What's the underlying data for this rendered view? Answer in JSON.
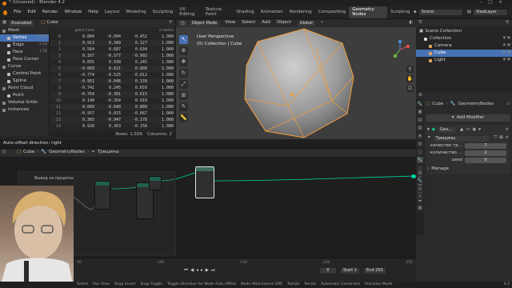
{
  "title": "* (Unsaved) - Blender 4.2",
  "menu": [
    "File",
    "Edit",
    "Render",
    "Window",
    "Help"
  ],
  "workspaces": [
    "Layout",
    "Modeling",
    "Sculpting",
    "UV Editing",
    "Texture Paint",
    "Shading",
    "Animation",
    "Rendering",
    "Compositing",
    "Geometry Nodes",
    "Scripting"
  ],
  "active_workspace": "Geometry Nodes",
  "scene_field": "Scene",
  "viewlayer_field": "ViewLayer",
  "spreadsheet": {
    "mode": "Evaluated",
    "object": "Cube",
    "tree": [
      {
        "label": "Mesh",
        "count": "",
        "indent": 0,
        "color": "#8a8a8a",
        "sel": false
      },
      {
        "label": "Vertex",
        "count": "1,556",
        "indent": 1,
        "color": "#bfbfbf",
        "sel": true
      },
      {
        "label": "Edge",
        "count": "2,16",
        "indent": 1,
        "color": "#bfbfbf",
        "sel": false
      },
      {
        "label": "Face",
        "count": "1,56",
        "indent": 1,
        "color": "#bfbfbf",
        "sel": false
      },
      {
        "label": "Face Corner",
        "count": "",
        "indent": 1,
        "color": "#bfbfbf",
        "sel": false
      },
      {
        "label": "Curve",
        "count": "",
        "indent": 0,
        "color": "#8a8a8a",
        "sel": false
      },
      {
        "label": "Control Point",
        "count": "",
        "indent": 1,
        "color": "#bfbfbf",
        "sel": false
      },
      {
        "label": "Spline",
        "count": "",
        "indent": 1,
        "color": "#bfbfbf",
        "sel": false
      },
      {
        "label": "Point Cloud",
        "count": "",
        "indent": 0,
        "color": "#8a8a8a",
        "sel": false
      },
      {
        "label": "Point",
        "count": "",
        "indent": 1,
        "color": "#bfbfbf",
        "sel": false
      },
      {
        "label": "Volume Grids",
        "count": "",
        "indent": 0,
        "color": "#8a8a8a",
        "sel": false
      },
      {
        "label": "Instances",
        "count": "",
        "indent": 0,
        "color": "#8a8a8a",
        "sel": false
      }
    ],
    "columns": [
      "",
      "position",
      "",
      "",
      "cracks"
    ],
    "rows": [
      [
        "0",
        "0.884",
        "-0.094",
        "-0.452",
        "1.000"
      ],
      [
        "1",
        "0.913",
        "0.349",
        "0.127",
        "1.000"
      ],
      [
        "2",
        "0.564",
        "0.687",
        "0.634",
        "1.000"
      ],
      [
        "3",
        "0.167",
        "-0.577",
        "-0.902",
        "1.000"
      ],
      [
        "4",
        "0.055",
        "0.938",
        "0.245",
        "1.000"
      ],
      [
        "5",
        "-0.069",
        "0.621",
        "0.800",
        "1.000"
      ],
      [
        "6",
        "-0.774",
        "-0.525",
        "-0.012",
        "1.000"
      ],
      [
        "7",
        "-0.951",
        "-0.046",
        "0.139",
        "1.000"
      ],
      [
        "8",
        "-0.741",
        "0.245",
        "0.659",
        "1.000"
      ],
      [
        "9",
        "-0.764",
        "-0.381",
        "0.615",
        "1.000"
      ],
      [
        "10",
        "0.140",
        "-0.354",
        "0.910",
        "1.000"
      ],
      [
        "11",
        "0.660",
        "-0.640",
        "0.880",
        "1.000"
      ],
      [
        "12",
        "-0.957",
        "0.015",
        "-0.067",
        "1.000"
      ],
      [
        "13",
        "0.365",
        "-0.947",
        "-0.178",
        "1.000"
      ],
      [
        "14",
        "0.928",
        "0.363",
        "-0.156",
        "1.000"
      ]
    ],
    "footer_rows": "Rows: 1,556",
    "footer_cols": "Columns: 2"
  },
  "viewport": {
    "mode": "Object Mode",
    "menus": [
      "View",
      "Select",
      "Add",
      "Object"
    ],
    "orientation": "Global",
    "overlay_title": "User Perspective",
    "overlay_sub": "(0) Collection | Cube"
  },
  "outliner": {
    "title": "Scene Collection",
    "items": [
      {
        "label": "Collection",
        "indent": 1,
        "sel": false,
        "color": "#d9d9d9"
      },
      {
        "label": "Camera",
        "indent": 2,
        "sel": false,
        "color": "#e0a35c"
      },
      {
        "label": "Cube",
        "indent": 2,
        "sel": true,
        "color": "#e0a35c"
      },
      {
        "label": "Light",
        "indent": 2,
        "sel": false,
        "color": "#e0a35c"
      }
    ]
  },
  "properties": {
    "breadcrumb_obj": "Cube",
    "breadcrumb_mod": "GeometryNodes",
    "add_modifier": "Add Modifier",
    "modifier_name": "Geo...",
    "nodegroup_name": "Трещины",
    "fields": [
      {
        "label": "качество тр...",
        "value": "7"
      },
      {
        "label": "количество ...",
        "value": "2"
      },
      {
        "label": "Seed",
        "value": "0"
      }
    ],
    "manage": "Manage"
  },
  "node_editor": {
    "status_msg": "Auto-offset direction: right",
    "crumb_obj": "Cube",
    "crumb_mod": "GeometryNodes",
    "crumb_group": "Трещины",
    "frame_label": "Вывод за пределы"
  },
  "timeline": {
    "current_frame": "0",
    "start_label": "Start",
    "start": "1",
    "end_label": "End",
    "end": "250",
    "ticks": [
      "50",
      "",
      "100",
      "",
      "150",
      "",
      "200",
      "",
      "250"
    ]
  },
  "statusbar": {
    "items": [
      "Select",
      "Pan View",
      "Snap Invert",
      "Snap Toggle",
      "Toggle Direction for Node Auto-Offset",
      "Node Attachment (Off)",
      "Rotate",
      "Resize",
      "Automatic Constraint",
      "Precision Mode"
    ],
    "version": "4.2"
  },
  "colors": {
    "accent": "#4772b3",
    "selection_orange": "#f29d39",
    "node_geo": "#00d6a3"
  }
}
